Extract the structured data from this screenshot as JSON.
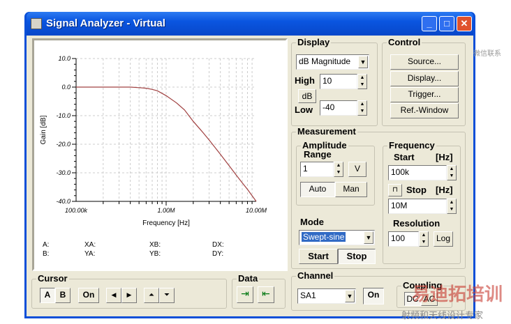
{
  "window": {
    "title": "Signal Analyzer - Virtual",
    "minimize": "_",
    "maximize": "□",
    "close": "✕"
  },
  "chart_data": {
    "type": "line",
    "xscale": "log",
    "xlim": [
      100000,
      10000000
    ],
    "ylim": [
      -40,
      10
    ],
    "xlabel": "Frequency [Hz]",
    "ylabel": "Gain [dB]",
    "xticks": [
      "100.00k",
      "1.00M",
      "10.00M"
    ],
    "yticks": [
      "10.0",
      "0.0",
      "-10.0",
      "-20.0",
      "-30.0",
      "-40.0"
    ],
    "grid": true,
    "color": "#a04040",
    "x": [
      100000,
      200000,
      300000,
      400000,
      500000,
      600000,
      700000,
      800000,
      1000000,
      1300000,
      1600000,
      2000000,
      2500000,
      3000000,
      4000000,
      5000000,
      6000000,
      7000000,
      8000000,
      10000000
    ],
    "y": [
      0,
      0,
      0,
      0,
      -0.2,
      -0.4,
      -0.8,
      -1.3,
      -3,
      -5.5,
      -8,
      -12,
      -15.5,
      -18.5,
      -23.5,
      -27.5,
      -30.8,
      -33.5,
      -35.8,
      -40
    ]
  },
  "readouts": {
    "a": "A:",
    "b": "B:",
    "xa": "XA:",
    "ya": "YA:",
    "xb": "XB:",
    "yb": "YB:",
    "dx": "DX:",
    "dy": "DY:"
  },
  "display": {
    "label": "Display",
    "mode": "dB Magnitude",
    "high_label": "High",
    "high": "10",
    "unit": "dB",
    "low_label": "Low",
    "low": "-40"
  },
  "control": {
    "label": "Control",
    "buttons": [
      "Source...",
      "Display...",
      "Trigger...",
      "Ref.-Window"
    ]
  },
  "measurement": {
    "label": "Measurement",
    "amplitude": "Amplitude",
    "range": "Range",
    "range_value": "1",
    "range_unit": "V",
    "auto": "Auto",
    "man": "Man",
    "mode_label": "Mode",
    "mode": "Swept-sine",
    "start": "Start",
    "stop": "Stop",
    "frequency": "Frequency",
    "start_label": "Start",
    "hz": "[Hz]",
    "start_value": "100k",
    "stop_label": "Stop",
    "stop_value": "10M",
    "resolution": "Resolution",
    "resolution_value": "100",
    "log": "Log"
  },
  "cursor": {
    "label": "Cursor",
    "a": "A",
    "b": "B",
    "on": "On",
    "left": "◀",
    "right": "▶",
    "up": "⏶",
    "down": "⏷"
  },
  "data": {
    "label": "Data"
  },
  "channel": {
    "label": "Channel",
    "value": "SA1",
    "on": "On",
    "coupling": "Coupling",
    "dc": "DC",
    "ac": "AC"
  },
  "watermark": {
    "top": "微信联系",
    "brand": "易迪拓培训",
    "slogan": "射频和天线设计专家"
  }
}
